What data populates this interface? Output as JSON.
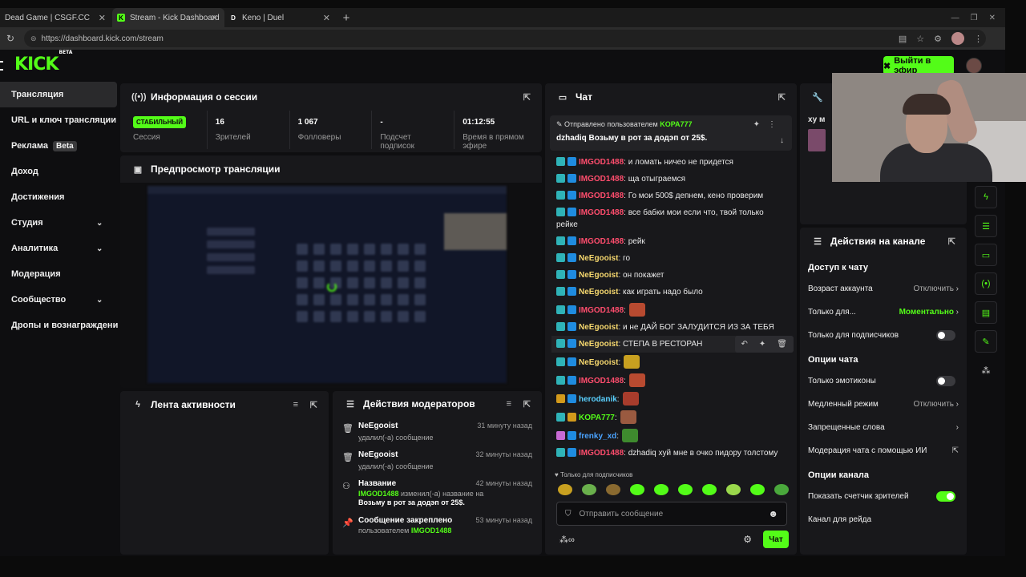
{
  "browser": {
    "tabs": [
      {
        "title": "Dead Game | CSGF.CC",
        "fav": "",
        "favcolor": "#222"
      },
      {
        "title": "Stream - Kick Dashboard",
        "fav": "K",
        "favcolor": "#53fc18"
      },
      {
        "title": "Keno | Duel",
        "fav": "D",
        "favcolor": "#222"
      }
    ],
    "url": "https://dashboard.kick.com/stream"
  },
  "app": {
    "logo": "KICK",
    "logo_badge": "BETA",
    "go_live": "Выйти в эфир"
  },
  "sidebar": {
    "items": [
      {
        "label": "Трансляция"
      },
      {
        "label": "URL и ключ трансляции"
      },
      {
        "label": "Реклама",
        "badge": "Beta"
      },
      {
        "label": "Доход"
      },
      {
        "label": "Достижения"
      },
      {
        "label": "Студия"
      },
      {
        "label": "Аналитика"
      },
      {
        "label": "Модерация"
      },
      {
        "label": "Сообщество"
      },
      {
        "label": "Дропы и вознаграждени"
      }
    ]
  },
  "session": {
    "title": "Информация о сессии",
    "stats": [
      {
        "value": "СТАБИЛЬНЫЙ",
        "label": "Сессия"
      },
      {
        "value": "16",
        "label": "Зрителей"
      },
      {
        "value": "1 067",
        "label": "Фолловеры"
      },
      {
        "value": "-",
        "label": "Подсчет подписок"
      },
      {
        "value": "01:12:55",
        "label": "Время в прямом эфире"
      }
    ]
  },
  "preview": {
    "title": "Предпросмотр трансляции"
  },
  "activity": {
    "title": "Лента активности"
  },
  "modactions": {
    "title": "Действия модераторов",
    "items": [
      {
        "title": "NeEgooist",
        "sub": "удалил(-а) сообщение",
        "time": "31 минуту назад"
      },
      {
        "title": "NeEgooist",
        "sub": "удалил(-а) сообщение",
        "time": "32 минуты назад"
      },
      {
        "title": "Название",
        "user": "IMGOD1488",
        "sub": " изменил(-а) название на ",
        "extra": "Возьму в рот за додэп от 25$.",
        "time": "42 минуты назад"
      },
      {
        "title": "Сообщение закреплено",
        "sub": "пользователем ",
        "user": "IMGOD1488",
        "time": "53 минуты назад"
      }
    ]
  },
  "chat": {
    "title": "Чат",
    "pinned_by_label": "Отправлено пользователем",
    "pinned_by": "KOPA777",
    "pinned_msg": "dzhadiq Возьму в рот за додэп от 25$.",
    "messages": [
      {
        "user": "IMGOD1488",
        "color": "#ff4d6d",
        "badges": [
          "sub",
          "kick"
        ],
        "text": ": и ломать ничео не придется"
      },
      {
        "user": "IMGOD1488",
        "color": "#ff4d6d",
        "badges": [
          "sub",
          "kick"
        ],
        "text": ": ща отыграемся"
      },
      {
        "user": "IMGOD1488",
        "color": "#ff4d6d",
        "badges": [
          "sub",
          "kick"
        ],
        "text": ": Го мои 500$ депнем, кено проверим"
      },
      {
        "user": "IMGOD1488",
        "color": "#ff4d6d",
        "badges": [
          "sub",
          "kick"
        ],
        "text": ": все бабки мои если что, твой только рейке"
      },
      {
        "user": "IMGOD1488",
        "color": "#ff4d6d",
        "badges": [
          "sub",
          "kick"
        ],
        "text": ": рейк"
      },
      {
        "user": "NeEgooist",
        "color": "#f5d76e",
        "badges": [
          "sub",
          "kick"
        ],
        "text": ": го"
      },
      {
        "user": "NeEgooist",
        "color": "#f5d76e",
        "badges": [
          "sub",
          "kick"
        ],
        "text": ": он покажет"
      },
      {
        "user": "NeEgooist",
        "color": "#f5d76e",
        "badges": [
          "sub",
          "kick"
        ],
        "text": ": как играть надо было"
      },
      {
        "user": "IMGOD1488",
        "color": "#ff4d6d",
        "badges": [
          "sub",
          "kick"
        ],
        "text": ":",
        "emote": "#b84a30"
      },
      {
        "user": "NeEgooist",
        "color": "#f5d76e",
        "badges": [
          "sub",
          "kick"
        ],
        "text": ": и не ДАЙ БОГ ЗАЛУДИТСЯ ИЗ ЗА ТЕБЯ"
      },
      {
        "user": "NeEgooist",
        "color": "#f5d76e",
        "badges": [
          "sub",
          "kick"
        ],
        "text": ": СТЕПА В РЕСТОРАН",
        "hl": true
      },
      {
        "user": "NeEgooist",
        "color": "#f5d76e",
        "badges": [
          "sub",
          "kick"
        ],
        "text": ":",
        "emote": "#c8a020"
      },
      {
        "user": "IMGOD1488",
        "color": "#ff4d6d",
        "badges": [
          "sub",
          "kick"
        ],
        "text": ":",
        "emote": "#b84a30"
      },
      {
        "user": "herodanik",
        "color": "#5ad1ff",
        "badges": [
          "crown",
          "kick"
        ],
        "text": ":",
        "emote": "#a83c2c"
      },
      {
        "user": "KOPA777",
        "color": "#53fc18",
        "badges": [
          "sub",
          "crown"
        ],
        "text": ":",
        "emote": "#9a5a40"
      },
      {
        "user": "frenky_xd",
        "color": "#4aa3ff",
        "badges": [
          "vip",
          "kick"
        ],
        "text": ":",
        "emote": "#3e8a2e"
      },
      {
        "user": "IMGOD1488",
        "color": "#ff4d6d",
        "badges": [
          "sub",
          "kick"
        ],
        "text": ": dzhadiq хуй мне в очко пидору толстому"
      }
    ],
    "sub_only_label": "Только для подписчиков",
    "input_placeholder": "Отправить сообщение",
    "send_label": "Чат"
  },
  "channel": {
    "title": "Действия на канале",
    "sections": [
      {
        "title": "Доступ к чату",
        "rows": [
          {
            "label": "Возраст аккаунта",
            "value": "Отключить",
            "type": "nav"
          },
          {
            "label": "Только для...",
            "value": "Моментально",
            "type": "nav",
            "green": true
          },
          {
            "label": "Только для подписчиков",
            "type": "toggle",
            "on": false
          }
        ]
      },
      {
        "title": "Опции чата",
        "rows": [
          {
            "label": "Только эмотиконы",
            "type": "toggle",
            "on": false
          },
          {
            "label": "Медленный режим",
            "value": "Отключить",
            "type": "nav"
          },
          {
            "label": "Запрещенные слова",
            "value": "",
            "type": "nav"
          },
          {
            "label": "Модерация чата с помощью ИИ",
            "type": "ext"
          }
        ]
      },
      {
        "title": "Опции канала",
        "rows": [
          {
            "label": "Показать счетчик зрителей",
            "type": "toggle",
            "on": true
          },
          {
            "label": "Канал для рейда",
            "type": "plain"
          }
        ]
      }
    ]
  },
  "side_panel_hint": "ху м"
}
